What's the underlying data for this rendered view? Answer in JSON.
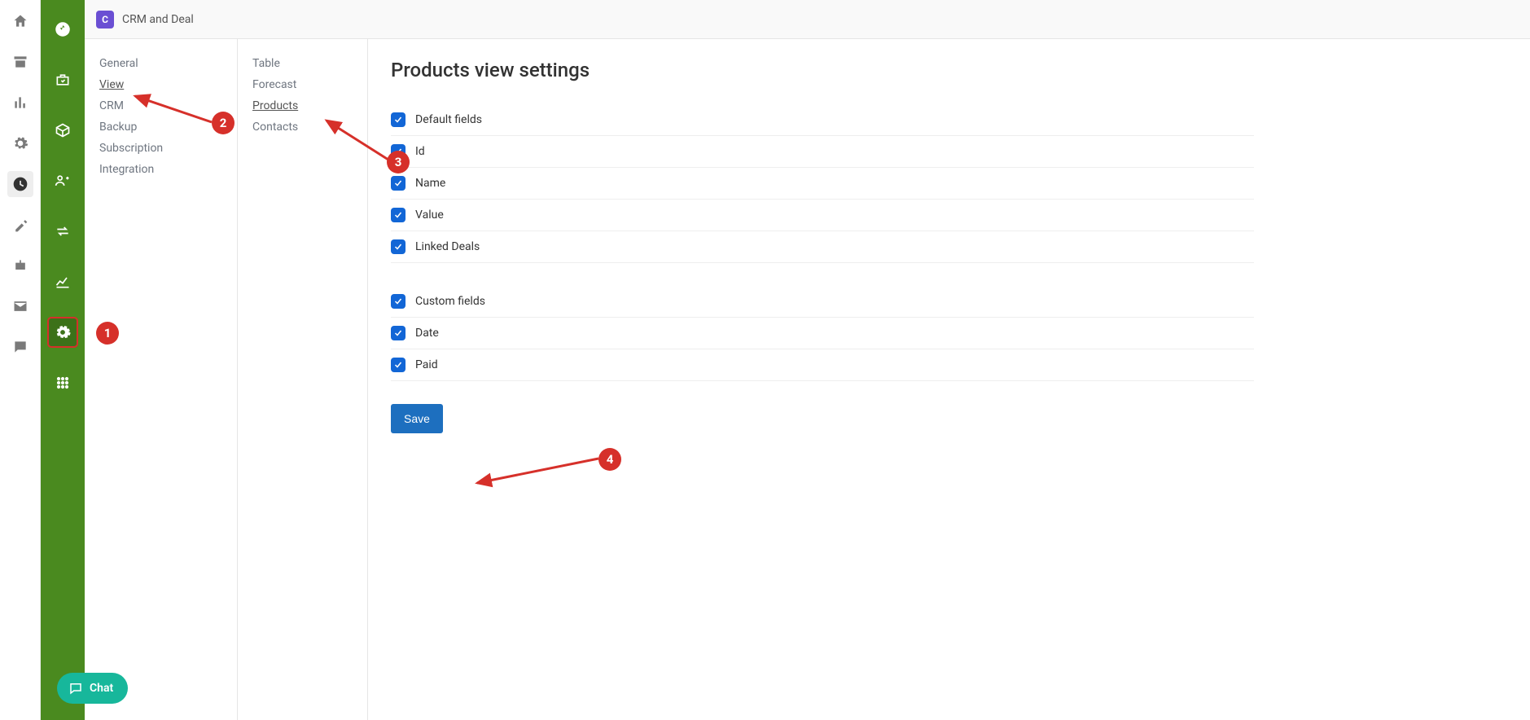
{
  "header": {
    "title": "CRM and Deal"
  },
  "nav1": {
    "items": [
      {
        "label": "General"
      },
      {
        "label": "View",
        "active": true
      },
      {
        "label": "CRM"
      },
      {
        "label": "Backup"
      },
      {
        "label": "Subscription"
      },
      {
        "label": "Integration"
      }
    ]
  },
  "nav2": {
    "items": [
      {
        "label": "Table"
      },
      {
        "label": "Forecast"
      },
      {
        "label": "Products",
        "active": true
      },
      {
        "label": "Contacts"
      }
    ]
  },
  "page": {
    "title": "Products view settings",
    "default_group": "Default fields",
    "default_fields": [
      {
        "label": "Id"
      },
      {
        "label": "Name"
      },
      {
        "label": "Value"
      },
      {
        "label": "Linked Deals"
      }
    ],
    "custom_group": "Custom fields",
    "custom_fields": [
      {
        "label": "Date"
      },
      {
        "label": "Paid"
      }
    ],
    "save_label": "Save"
  },
  "chat": {
    "label": "Chat"
  },
  "annotations": {
    "b1": "1",
    "b2": "2",
    "b3": "3",
    "b4": "4"
  }
}
